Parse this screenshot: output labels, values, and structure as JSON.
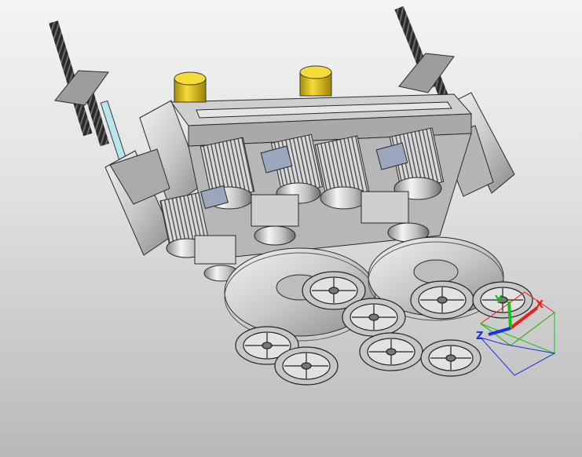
{
  "viewport": {
    "background_top": "#f4f4f4",
    "background_bottom": "#b9b9b9"
  },
  "model": {
    "metal_color": "#c9c9c9",
    "dark_metal_color": "#7a7a7a",
    "motor_cap_color": "#e0c21a",
    "spring_color": "#2a2a2a",
    "lead_rod_color": "#b7e6ec"
  },
  "triad": {
    "x_label": "X",
    "y_label": "Y",
    "z_label": "Z",
    "x_color": "#e8201a",
    "y_color": "#16c21a",
    "z_color": "#1a2fe8"
  }
}
